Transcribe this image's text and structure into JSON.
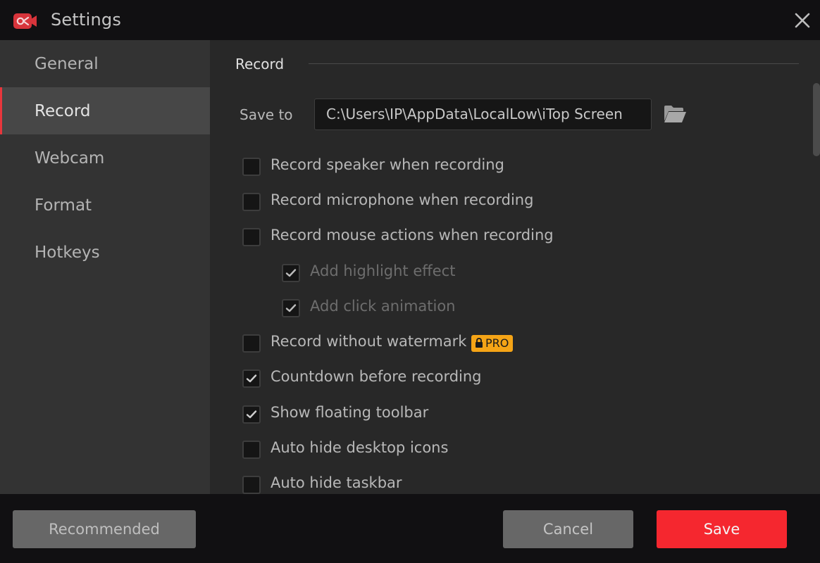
{
  "window": {
    "title": "Settings",
    "logo_icon": "video-camera-logo-icon",
    "close_icon": "close-icon"
  },
  "colors": {
    "accent": "#e8363c",
    "save_button": "#f5272f",
    "pro_badge": "#f5a416",
    "sidebar_bg": "#333333",
    "sidebar_active_bg": "#474747",
    "main_bg": "#282828",
    "chrome_bg": "#111012"
  },
  "sidebar": {
    "items": [
      {
        "label": "General",
        "active": false
      },
      {
        "label": "Record",
        "active": true
      },
      {
        "label": "Webcam",
        "active": false
      },
      {
        "label": "Format",
        "active": false
      },
      {
        "label": "Hotkeys",
        "active": false
      }
    ]
  },
  "main": {
    "section_title": "Record",
    "save_to": {
      "label": "Save to",
      "value": "C:\\Users\\IP\\AppData\\LocalLow\\iTop Screen",
      "browse_icon": "folder-open-icon"
    },
    "options": [
      {
        "label": "Record speaker when recording",
        "checked": false,
        "indent": false,
        "disabled": false
      },
      {
        "label": "Record microphone when recording",
        "checked": false,
        "indent": false,
        "disabled": false
      },
      {
        "label": "Record mouse actions when recording",
        "checked": false,
        "indent": false,
        "disabled": false
      },
      {
        "label": "Add highlight effect",
        "checked": true,
        "indent": true,
        "disabled": true
      },
      {
        "label": "Add click animation",
        "checked": true,
        "indent": true,
        "disabled": true
      },
      {
        "label": "Record without watermark",
        "checked": false,
        "indent": false,
        "disabled": false,
        "badge": "PRO",
        "badge_icon": "lock-icon"
      },
      {
        "label": "Countdown before recording",
        "checked": true,
        "indent": false,
        "disabled": false
      },
      {
        "label": "Show floating toolbar",
        "checked": true,
        "indent": false,
        "disabled": false
      },
      {
        "label": "Auto hide desktop icons",
        "checked": false,
        "indent": false,
        "disabled": false
      },
      {
        "label": "Auto hide taskbar",
        "checked": false,
        "indent": false,
        "disabled": false
      }
    ]
  },
  "footer": {
    "recommended_label": "Recommended",
    "cancel_label": "Cancel",
    "save_label": "Save"
  }
}
